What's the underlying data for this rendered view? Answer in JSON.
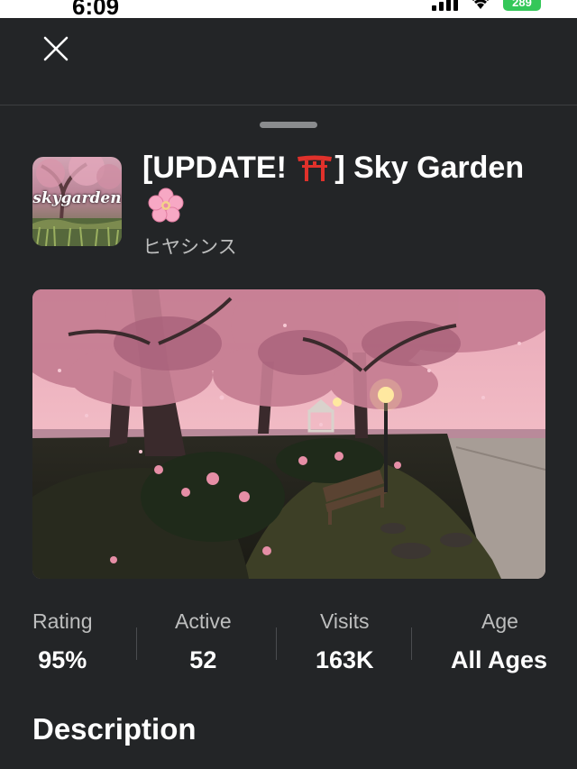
{
  "status_bar": {
    "time": "6:09",
    "battery": "289",
    "icons": [
      "signal-icon",
      "wifi-icon",
      "battery-icon"
    ]
  },
  "topbar": {
    "close_icon": "close-icon"
  },
  "game": {
    "title_part1": "[UPDATE!",
    "title_part2": "] Sky Garden",
    "title_emojis": [
      "torii-icon",
      "blossom-icon"
    ],
    "creator": "ヒヤシンス",
    "icon_text": "skygarden"
  },
  "stats": [
    {
      "label": "Rating",
      "value": "95%"
    },
    {
      "label": "Active",
      "value": "52"
    },
    {
      "label": "Visits",
      "value": "163K"
    },
    {
      "label": "Age",
      "value": "All Ages"
    }
  ],
  "description": {
    "heading": "Description"
  },
  "colors": {
    "background": "#232527",
    "text_primary": "#ffffff",
    "text_secondary": "#bdbebe",
    "battery": "#34c759",
    "torii": "#e0312b",
    "blossom": "#f7a8c4"
  }
}
